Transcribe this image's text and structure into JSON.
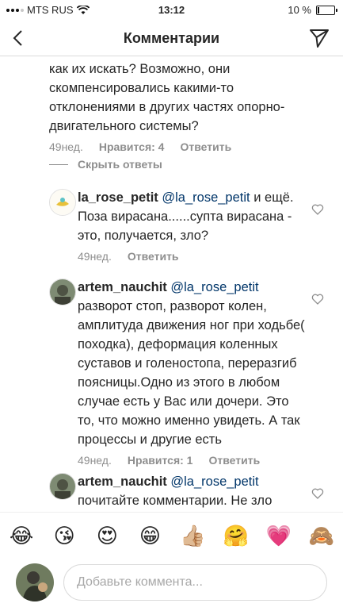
{
  "status": {
    "carrier": "MTS RUS",
    "time": "13:12",
    "battery": "10 %",
    "battery_level": 0.1
  },
  "header": {
    "title": "Комментарии"
  },
  "parent_comment": {
    "text": "как их искать? Возможно, они скомпенсировались какими-то отклонениями в других частях опорно-двигательного системы?",
    "time": "49нед.",
    "likes": "Нравится: 4",
    "reply_label": "Ответить"
  },
  "hide_replies_label": "Скрыть ответы",
  "replies": [
    {
      "username": "la_rose_petit",
      "mention": "@la_rose_petit",
      "text": "и ещё. Поза вирасана......супта вирасана - это, получается, зло?",
      "time": "49нед.",
      "reply_label": "Ответить"
    },
    {
      "username": "artem_nauchit",
      "mention": "@la_rose_petit",
      "text": "разворот стоп, разворот колен, амплитуда движения ног при ходьбе( походка), деформация коленных суставов и голеностопа, переразгиб поясницы.Одно из этого в любом случае есть у Вас или дочери. Это то, что можно именно увидеть. А так процессы и другие есть",
      "time": "49нед.",
      "likes": "Нравится: 1",
      "reply_label": "Ответить"
    },
    {
      "username": "artem_nauchit",
      "mention": "@la_rose_petit",
      "text": "почитайте комментарии. Не зло"
    }
  ],
  "emoji_bar": [
    "😂",
    "😘",
    "😍",
    "😁",
    "👍🏼",
    "🤗",
    "💗",
    "🙈"
  ],
  "comment_input": {
    "placeholder": "Добавьте коммента..."
  }
}
